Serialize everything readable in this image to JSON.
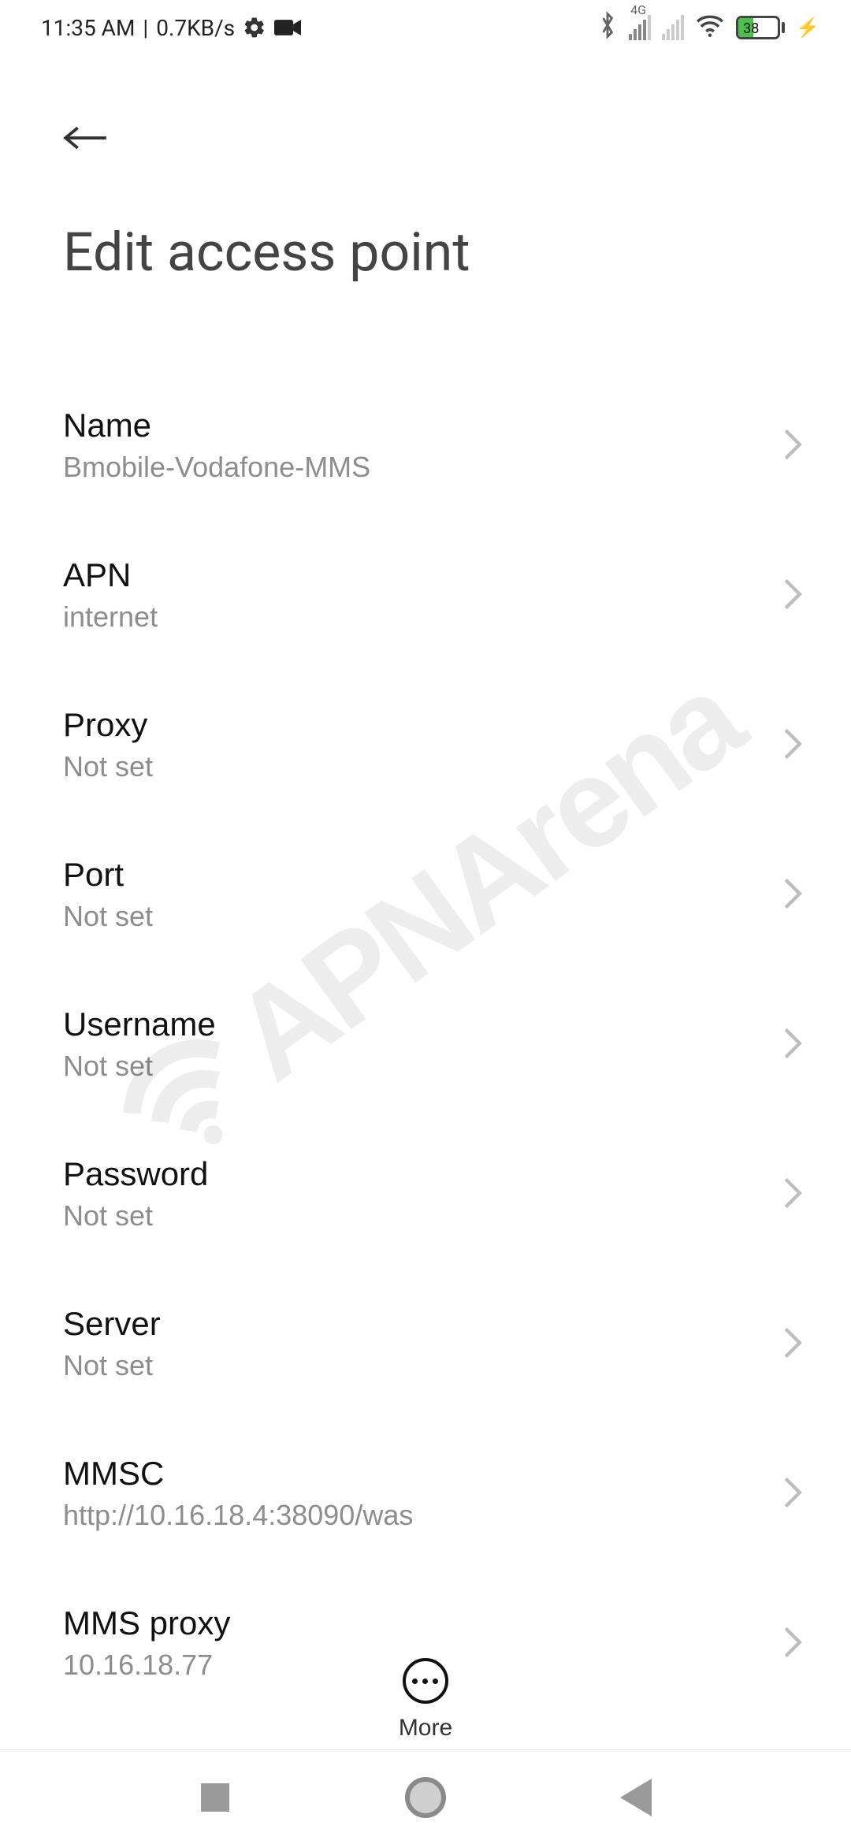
{
  "status_bar": {
    "time": "11:35 AM",
    "separator": "|",
    "data_rate": "0.7KB/s",
    "network_label": "4G",
    "battery_percent": "38"
  },
  "header": {
    "title": "Edit access point"
  },
  "settings": [
    {
      "key": "name",
      "label": "Name",
      "value": "Bmobile-Vodafone-MMS"
    },
    {
      "key": "apn",
      "label": "APN",
      "value": "internet"
    },
    {
      "key": "proxy",
      "label": "Proxy",
      "value": "Not set"
    },
    {
      "key": "port",
      "label": "Port",
      "value": "Not set"
    },
    {
      "key": "username",
      "label": "Username",
      "value": "Not set"
    },
    {
      "key": "password",
      "label": "Password",
      "value": "Not set"
    },
    {
      "key": "server",
      "label": "Server",
      "value": "Not set"
    },
    {
      "key": "mmsc",
      "label": "MMSC",
      "value": "http://10.16.18.4:38090/was"
    },
    {
      "key": "mmsproxy",
      "label": "MMS proxy",
      "value": "10.16.18.77"
    }
  ],
  "bottom": {
    "more_label": "More"
  },
  "watermark": {
    "text": "APNArena"
  }
}
